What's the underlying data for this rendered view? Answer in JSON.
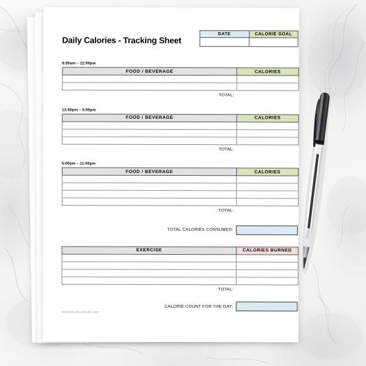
{
  "document": {
    "title": "Daily Calories - Tracking Sheet",
    "watermark": "PRINTABLEPLANNING.COM"
  },
  "header_table": {
    "columns": [
      "DATE",
      "CALORIE GOAL"
    ],
    "values": [
      "",
      ""
    ],
    "colors": {
      "date": "#dcebf2",
      "calorie_goal": "#d9e3bd"
    }
  },
  "meal_sections": [
    {
      "time_label": "6:00am – 12:00pm",
      "columns": [
        "FOOD / BEVERAGE",
        "CALORIES"
      ],
      "row_count": 2,
      "total_label": "TOTAL:",
      "total_value": ""
    },
    {
      "time_label": "12:00pm – 5:00pm",
      "columns": [
        "FOOD / BEVERAGE",
        "CALORIES"
      ],
      "row_count": 3,
      "total_label": "TOTAL:",
      "total_value": ""
    },
    {
      "time_label": "5:00pm – 11:00pm",
      "columns": [
        "FOOD / BEVERAGE",
        "CALORIES"
      ],
      "row_count": 4,
      "total_label": "TOTAL:",
      "total_value": ""
    }
  ],
  "total_consumed": {
    "label": "TOTAL CALORIES CONSUMED:",
    "value": "",
    "color": "#dcebf2"
  },
  "exercise_section": {
    "columns": [
      "EXERCISE",
      "CALORIES BURNED"
    ],
    "row_count": 4,
    "total_label": "TOTAL:",
    "total_value": "",
    "header_colors": {
      "exercise": "#e2e2e2",
      "calories_burned": "#f6dedd"
    }
  },
  "day_total": {
    "label": "CALORIE COUNT FOR THE DAY:",
    "value": "",
    "color": "#dcebf2"
  },
  "scene": {
    "background": "white-marble",
    "objects": [
      "paper-stack",
      "ballpoint-pen"
    ]
  }
}
